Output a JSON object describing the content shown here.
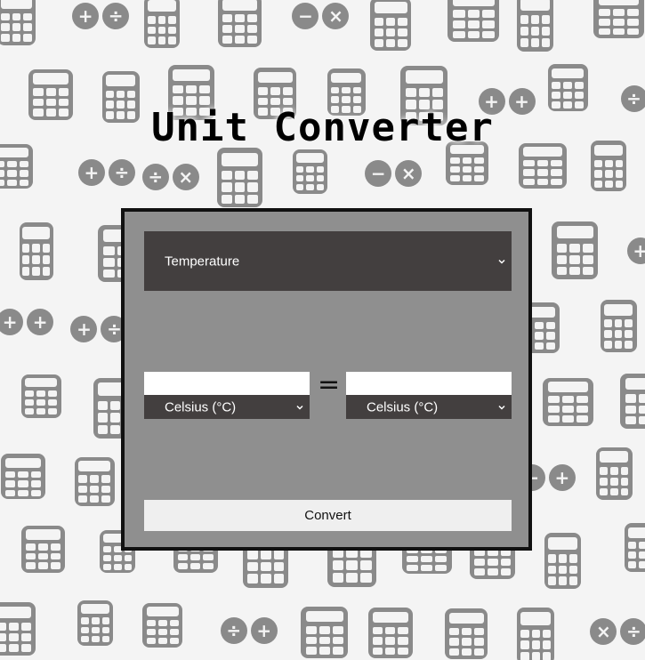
{
  "page": {
    "title": "Unit Converter"
  },
  "converter": {
    "category": {
      "selected": "Temperature"
    },
    "from": {
      "value": "",
      "unit": "Celsius (°C)"
    },
    "equals_sign": "=",
    "to": {
      "value": "",
      "unit": "Celsius (°C)"
    },
    "convert_label": "Convert"
  },
  "icons": {
    "dropdown": "chevron-down-icon"
  },
  "colors": {
    "panel_bg": "#8f8f8f",
    "panel_border": "#111111",
    "select_bg": "#433f3f",
    "button_bg": "#efefef",
    "pattern": "#8a8a8a"
  }
}
